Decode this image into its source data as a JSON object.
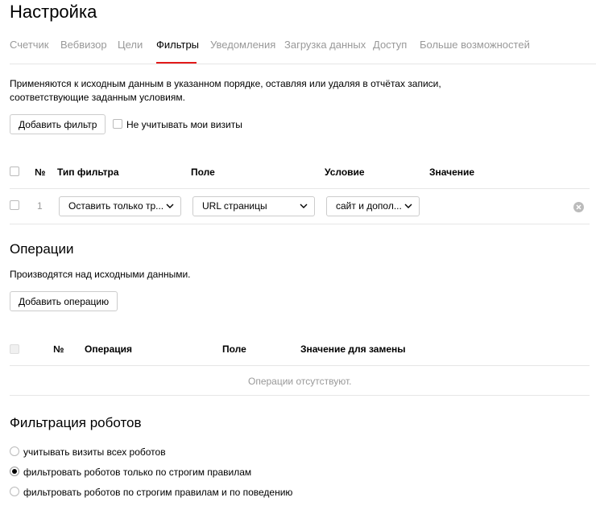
{
  "page": {
    "title": "Настройка"
  },
  "tabs": [
    {
      "label": "Счетчик",
      "active": false
    },
    {
      "label": "Вебвизор",
      "active": false
    },
    {
      "label": "Цели",
      "active": false
    },
    {
      "label": "Фильтры",
      "active": true
    },
    {
      "label": "Уведомления",
      "active": false
    },
    {
      "label": "Загрузка данных",
      "active": false
    },
    {
      "label": "Доступ",
      "active": false
    },
    {
      "label": "Больше возможностей",
      "active": false
    }
  ],
  "filters": {
    "description_line1": "Применяются к исходным данным в указанном порядке, оставляя или удаляя в отчётах записи,",
    "description_line2": "соответствующие заданным условиям.",
    "add_button": "Добавить фильтр",
    "ignore_my_visits_label": "Не учитывать мои визиты",
    "ignore_my_visits_checked": false,
    "columns": {
      "num": "№",
      "type": "Тип фильтра",
      "field": "Поле",
      "condition": "Условие",
      "value": "Значение"
    },
    "rows": [
      {
        "num": "1",
        "type": "Оставить только тр...",
        "field": "URL страницы",
        "condition": "сайт и допол...",
        "value": ""
      }
    ]
  },
  "operations": {
    "title": "Операции",
    "description": "Производятся над исходными данными.",
    "add_button": "Добавить операцию",
    "columns": {
      "num": "№",
      "operation": "Операция",
      "field": "Поле",
      "replace_value": "Значение для замены"
    },
    "empty_text": "Операции отсутствуют."
  },
  "robots": {
    "title": "Фильтрация роботов",
    "options": [
      {
        "label": "учитывать визиты всех роботов",
        "checked": false
      },
      {
        "label": "фильтровать роботов только по строгим правилам",
        "checked": true
      },
      {
        "label": "фильтровать роботов по строгим правилам и по поведению",
        "checked": false
      }
    ]
  },
  "colors": {
    "accent": "#e21a1a",
    "muted_text": "#999999",
    "border": "#e6e6e6"
  },
  "icons": {
    "dropdown": "chevron-down-icon",
    "remove": "close-circle-icon"
  }
}
